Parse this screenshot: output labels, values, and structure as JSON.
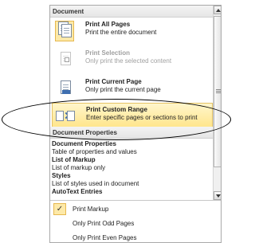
{
  "document_section": {
    "header": "Document",
    "options": [
      {
        "title": "Print All Pages",
        "desc": "Print the entire document",
        "icon": "print-all-pages-icon",
        "state": "selected"
      },
      {
        "title": "Print Selection",
        "desc": "Only print the selected content",
        "icon": "print-selection-icon",
        "state": "disabled"
      },
      {
        "title": "Print Current Page",
        "desc": "Only print the current page",
        "icon": "print-current-page-icon",
        "state": "normal"
      },
      {
        "title": "Print Custom Range",
        "desc": "Enter specific pages or sections to print",
        "icon": "print-custom-range-icon",
        "state": "highlighted"
      }
    ]
  },
  "properties_section": {
    "header": "Document Properties",
    "items": [
      {
        "title": "Document Properties",
        "desc": "Table of properties and values"
      },
      {
        "title": "List of Markup",
        "desc": "List of markup only"
      },
      {
        "title": "Styles",
        "desc": "List of styles used in document"
      },
      {
        "title": "AutoText Entries",
        "desc": ""
      }
    ]
  },
  "menu_items": [
    {
      "label": "Print Markup",
      "checked": true,
      "check_glyph": "✓"
    },
    {
      "label": "Only Print Odd Pages",
      "checked": false
    },
    {
      "label": "Only Print Even Pages",
      "checked": false
    }
  ],
  "colors": {
    "highlight": "#ffe58a",
    "highlight_border": "#e5c365",
    "accent_blue": "#3f6fb0",
    "disabled_text": "#a0a0a0"
  }
}
